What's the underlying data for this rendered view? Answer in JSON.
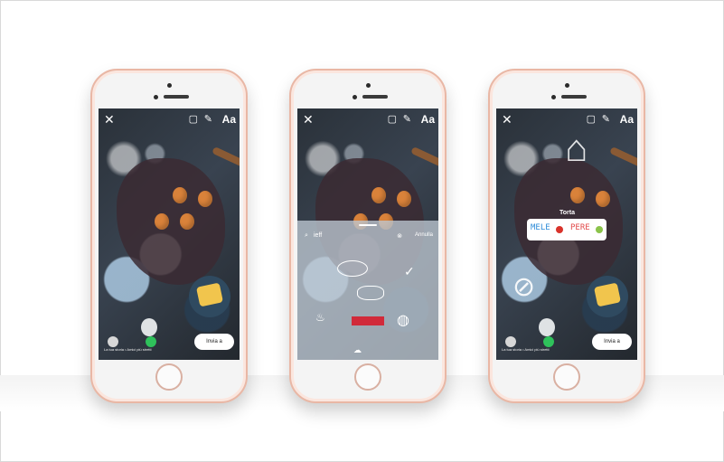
{
  "phones": [
    {
      "toolbar": {
        "close_icon": "close-icon",
        "aa_label": "Aa"
      },
      "bottom": {
        "caption": "La tua storia  •  Amici più stretti",
        "send_label": "Invia a"
      }
    },
    {
      "toolbar": {
        "close_icon": "close-icon",
        "aa_label": "Aa"
      },
      "sticker_tray": {
        "search_value": "ieff",
        "cancel_label": "Annulla"
      }
    },
    {
      "toolbar": {
        "close_icon": "close-icon",
        "aa_label": "Aa"
      },
      "sticker_overlay": {
        "title": "Torta",
        "left_word": "MELE",
        "right_word": "PERE"
      },
      "bottom": {
        "caption": "La tua storia  •  Amici più stretti",
        "send_label": "Invia a"
      }
    }
  ],
  "colors": {
    "phone_rose_gold": "#e9b7a5",
    "send_green": "#2fc25b",
    "sticker_red": "#d12a3a"
  }
}
